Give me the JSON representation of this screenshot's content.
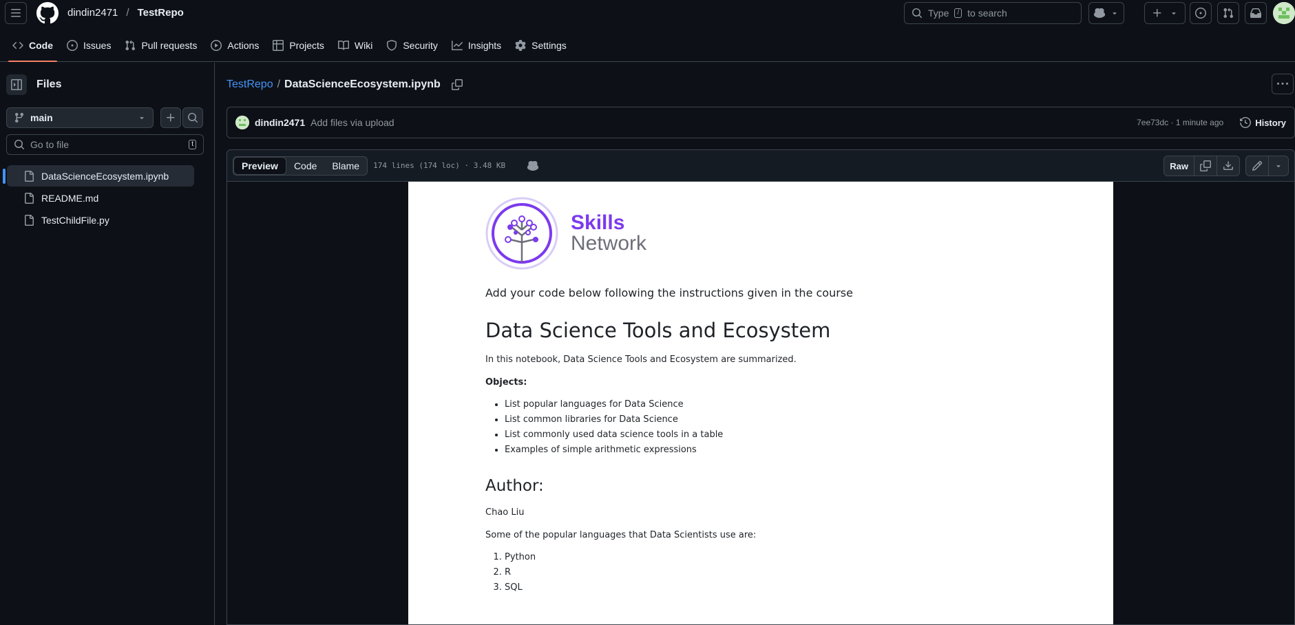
{
  "header": {
    "owner": "dindin2471",
    "separator": "/",
    "repo": "TestRepo",
    "search_prefix": "Type",
    "search_key": "/",
    "search_suffix": "to search"
  },
  "repo_tabs": [
    {
      "label": "Code",
      "icon": "code-icon"
    },
    {
      "label": "Issues",
      "icon": "issue-opened-icon"
    },
    {
      "label": "Pull requests",
      "icon": "git-pull-request-icon"
    },
    {
      "label": "Actions",
      "icon": "play-icon"
    },
    {
      "label": "Projects",
      "icon": "table-icon"
    },
    {
      "label": "Wiki",
      "icon": "book-icon"
    },
    {
      "label": "Security",
      "icon": "shield-icon"
    },
    {
      "label": "Insights",
      "icon": "graph-icon"
    },
    {
      "label": "Settings",
      "icon": "gear-icon"
    }
  ],
  "sidebar": {
    "title": "Files",
    "branch": "main",
    "goto_placeholder": "Go to file",
    "goto_key": "t",
    "files": [
      {
        "name": "DataScienceEcosystem.ipynb",
        "active": true
      },
      {
        "name": "README.md",
        "active": false
      },
      {
        "name": "TestChildFile.py",
        "active": false
      }
    ]
  },
  "breadcrumb": {
    "repo": "TestRepo",
    "separator": "/",
    "file": "DataScienceEcosystem.ipynb"
  },
  "commit": {
    "author": "dindin2471",
    "message": "Add files via upload",
    "meta": "7ee73dc · 1 minute ago",
    "history_label": "History"
  },
  "file_header": {
    "views": [
      "Preview",
      "Code",
      "Blame"
    ],
    "active_view": "Preview",
    "info": "174 lines (174 loc) · 3.48 KB",
    "raw_label": "Raw"
  },
  "notebook": {
    "logo_line1": "Skills",
    "logo_line2": "Network",
    "intro": "Add your code below following the instructions given in the course",
    "title": "Data Science Tools and Ecosystem",
    "summary": "In this notebook, Data Science Tools and Ecosystem are summarized.",
    "objects_label": "Objects:",
    "objects": [
      "List popular languages for Data Science",
      "List common libraries for Data Science",
      "List commonly used data science tools in a table",
      "Examples of simple arithmetic expressions"
    ],
    "author_heading": "Author:",
    "author_name": "Chao Liu",
    "languages_intro": "Some of the popular languages that Data Scientists use are:",
    "languages": [
      "Python",
      "R",
      "SQL"
    ]
  },
  "colors": {
    "background": "#0d1117",
    "border": "#3d444d",
    "link": "#4493f8",
    "active_tab_underline": "#f78166",
    "skills_purple": "#7c3aed"
  }
}
